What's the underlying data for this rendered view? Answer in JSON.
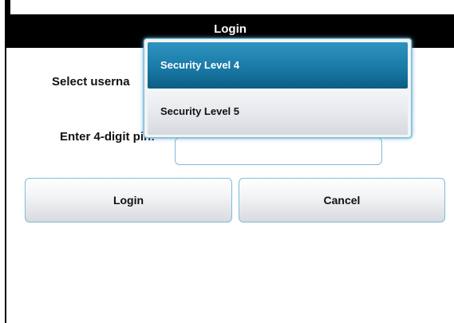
{
  "title": "Login",
  "form": {
    "username_label": "Select userna",
    "pin_label": "Enter 4-digit pin:",
    "pin_value": ""
  },
  "buttons": {
    "login_label": "Login",
    "cancel_label": "Cancel"
  },
  "dropdown": {
    "items": [
      {
        "label": "Security Level 4",
        "selected": true
      },
      {
        "label": "Security Level 5",
        "selected": false
      }
    ]
  },
  "colors": {
    "title_bar": "#000000",
    "accent": "#1a7aa7",
    "border": "#7fbcd8"
  }
}
